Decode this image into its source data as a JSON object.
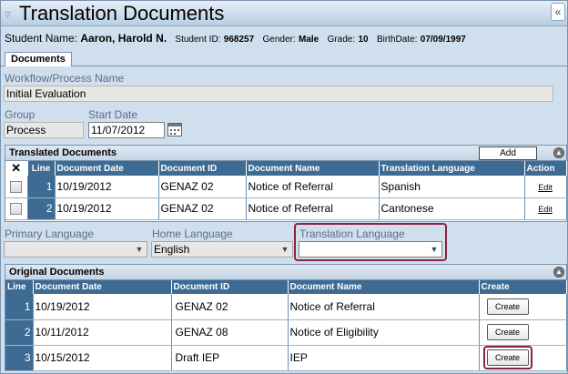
{
  "window": {
    "title": "Translation Documents",
    "filter_icon": "funnel-icon",
    "collapse_icon": "double-chevron-left-icon"
  },
  "student": {
    "name_label": "Student Name:",
    "name": "Aaron, Harold N.",
    "id_label": "Student ID:",
    "id": "968257",
    "gender_label": "Gender:",
    "gender": "Male",
    "grade_label": "Grade:",
    "grade": "10",
    "birth_label": "BirthDate:",
    "birth": "07/09/1997"
  },
  "tabs": [
    {
      "label": "Documents"
    }
  ],
  "form": {
    "workflow_label": "Workflow/Process Name",
    "workflow_value": "Initial Evaluation",
    "group_label": "Group",
    "group_value": "Process",
    "start_date_label": "Start Date",
    "start_date_value": "11/07/2012"
  },
  "translated": {
    "title": "Translated Documents",
    "add_label": "Add",
    "columns": [
      "Line",
      "Document Date",
      "Document ID",
      "Document Name",
      "Translation Language",
      "Action"
    ],
    "rows": [
      {
        "line": "1",
        "date": "10/19/2012",
        "doc_id": "GENAZ 02",
        "name": "Notice of Referral",
        "language": "Spanish",
        "action": "Edit"
      },
      {
        "line": "2",
        "date": "10/19/2012",
        "doc_id": "GENAZ 02",
        "name": "Notice of Referral",
        "language": "Cantonese",
        "action": "Edit"
      }
    ]
  },
  "languages": {
    "primary_label": "Primary Language",
    "primary_value": "",
    "home_label": "Home Language",
    "home_value": "English",
    "translation_label": "Translation Language",
    "translation_value": ""
  },
  "original": {
    "title": "Original Documents",
    "columns": [
      "Line",
      "Document Date",
      "Document ID",
      "Document Name",
      "Create"
    ],
    "rows": [
      {
        "line": "1",
        "date": "10/19/2012",
        "doc_id": "GENAZ 02",
        "name": "Notice of Referral",
        "action": "Create"
      },
      {
        "line": "2",
        "date": "10/11/2012",
        "doc_id": "GENAZ 08",
        "name": "Notice of Eligibility",
        "action": "Create"
      },
      {
        "line": "3",
        "date": "10/15/2012",
        "doc_id": "Draft IEP",
        "name": "IEP",
        "action": "Create"
      }
    ]
  },
  "colors": {
    "header_blue": "#3e6b94",
    "panel_bg": "#cfdfee",
    "highlight": "#8b2040"
  }
}
